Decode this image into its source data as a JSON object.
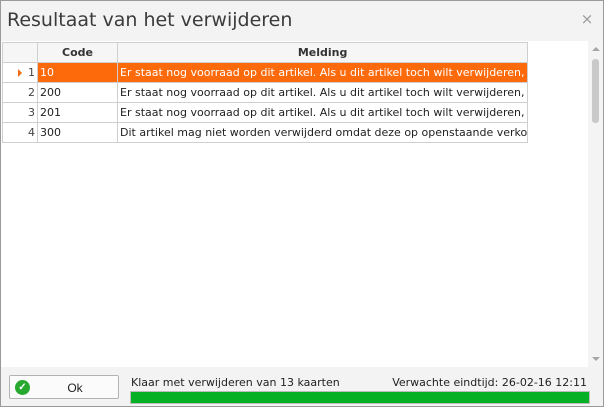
{
  "window": {
    "title": "Resultaat van het verwijderen",
    "close_glyph": "×"
  },
  "table": {
    "columns": [
      "Code",
      "Melding"
    ],
    "rows": [
      {
        "num": "1",
        "code": "10",
        "message": "Er staat nog voorraad op dit artikel. Als u dit artikel toch wilt verwijderen, ",
        "selected": true
      },
      {
        "num": "2",
        "code": "200",
        "message": "Er staat nog voorraad op dit artikel. Als u dit artikel toch wilt verwijderen, ",
        "selected": false
      },
      {
        "num": "3",
        "code": "201",
        "message": "Er staat nog voorraad op dit artikel. Als u dit artikel toch wilt verwijderen, ",
        "selected": false
      },
      {
        "num": "4",
        "code": "300",
        "message": "Dit artikel mag niet worden verwijderd omdat deze op openstaande verko",
        "selected": false
      }
    ],
    "selected_color": "#fc6a0b"
  },
  "footer": {
    "ok_label": "Ok",
    "ok_icon": "check-circle-icon",
    "status": "Klaar met verwijderen van 13 kaarten",
    "eta": "Verwachte eindtijd: 26-02-16 12:11",
    "progress_percent": 100,
    "progress_color": "#06b025"
  }
}
